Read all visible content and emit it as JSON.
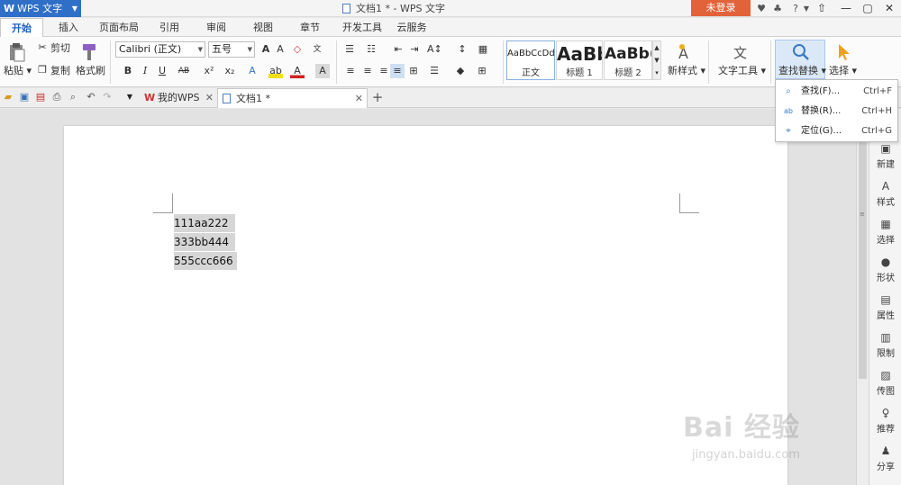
{
  "titlebar": {
    "app_name": "WPS 文字",
    "window_title": "文档1 * - WPS 文字",
    "login_label": "未登录",
    "help_label": "?"
  },
  "menu": {
    "tabs": [
      "开始",
      "插入",
      "页面布局",
      "引用",
      "审阅",
      "视图",
      "章节",
      "开发工具",
      "云服务"
    ],
    "active_index": 0
  },
  "ribbon": {
    "paste": "粘贴",
    "cut": "剪切",
    "copy": "复制",
    "format_painter": "格式刷",
    "font_name": "Calibri (正文)",
    "font_size": "五号",
    "styles": [
      {
        "sample": "AaBbCcDd",
        "name": "正文"
      },
      {
        "sample": "AaBb",
        "name": "标题 1"
      },
      {
        "sample": "AaBb(",
        "name": "标题 2"
      }
    ],
    "new_style": "新样式",
    "text_tools": "文字工具",
    "find_replace": "查找替换",
    "select": "选择"
  },
  "doc_tabs": [
    {
      "label": "我的WPS"
    },
    {
      "label": "文档1 *"
    }
  ],
  "document": {
    "lines": [
      "111aa222",
      "333bb444",
      "555ccc666"
    ]
  },
  "find_menu": {
    "items": [
      {
        "label": "查找(F)...",
        "shortcut": "Ctrl+F"
      },
      {
        "label": "替换(R)...",
        "shortcut": "Ctrl+H"
      },
      {
        "label": "定位(G)...",
        "shortcut": "Ctrl+G"
      }
    ]
  },
  "side_pane": {
    "items": [
      "新建",
      "样式",
      "选择",
      "形状",
      "属性",
      "限制",
      "传图",
      "推荐",
      "分享"
    ]
  },
  "watermark": {
    "main": "Bai 经验",
    "url": "jingyan.baidu.com"
  },
  "colors": {
    "accent": "#2f6fc7",
    "login": "#e2623a",
    "selection": "#d6d6d6",
    "find_highlight": "#dbe8f7"
  }
}
